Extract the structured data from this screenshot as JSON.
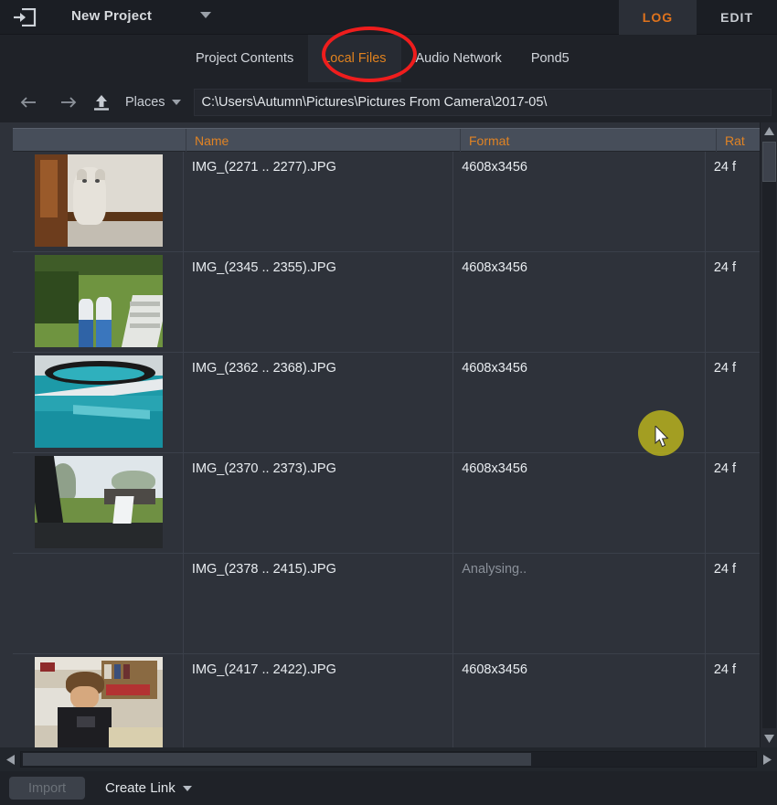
{
  "window": {
    "exit_icon": "exit-icon",
    "project_title": "New Project",
    "project_caret": "chevron-down-icon"
  },
  "mode_tabs": [
    {
      "label": "LOG",
      "active": true
    },
    {
      "label": "EDIT",
      "active": false
    }
  ],
  "sub_tabs": [
    {
      "label": "Project Contents",
      "active": false
    },
    {
      "label": "Local Files",
      "active": true
    },
    {
      "label": "Audio Network",
      "active": false
    },
    {
      "label": "Pond5",
      "active": false
    }
  ],
  "navbar": {
    "back_icon": "arrow-left-icon",
    "forward_icon": "arrow-right-icon",
    "up_icon": "arrow-up-folder-icon",
    "places_label": "Places",
    "places_caret": "chevron-down-icon",
    "path_value": "C:\\Users\\Autumn\\Pictures\\Pictures From Camera\\2017-05\\"
  },
  "table": {
    "columns": [
      {
        "key": "thumb",
        "label": ""
      },
      {
        "key": "name",
        "label": "Name"
      },
      {
        "key": "format",
        "label": "Format"
      },
      {
        "key": "rate",
        "label": "Rat"
      }
    ],
    "rows": [
      {
        "name": "IMG_(2271 .. 2277).JPG",
        "format": "4608x3456",
        "rate": "24 f",
        "analysing": false,
        "thumb": "cat-in-hallway"
      },
      {
        "name": "IMG_(2345 .. 2355).JPG",
        "format": "4608x3456",
        "rate": "24 f",
        "analysing": false,
        "thumb": "legs-on-lawn"
      },
      {
        "name": "IMG_(2362 .. 2368).JPG",
        "format": "4608x3456",
        "rate": "24 f",
        "analysing": false,
        "thumb": "teal-blanket"
      },
      {
        "name": "IMG_(2370 .. 2373).JPG",
        "format": "4608x3456",
        "rate": "24 f",
        "analysing": false,
        "thumb": "car-window-yard"
      },
      {
        "name": "IMG_(2378 .. 2415).JPG",
        "format": "Analysing..",
        "rate": "24 f",
        "analysing": true,
        "thumb": ""
      },
      {
        "name": "IMG_(2417 .. 2422).JPG",
        "format": "4608x3456",
        "rate": "24 f",
        "analysing": false,
        "thumb": "boy-at-desk"
      }
    ]
  },
  "scrollbars": {
    "vertical": {
      "up_icon": "triangle-up-icon",
      "down_icon": "triangle-down-icon"
    },
    "horizontal": {
      "left_icon": "triangle-left-icon",
      "right_icon": "triangle-right-icon"
    }
  },
  "footer": {
    "import_label": "Import",
    "import_disabled": true,
    "create_link_label": "Create Link",
    "create_link_caret": "chevron-down-icon"
  },
  "annotations": {
    "highlight_ellipse_target": "Local Files",
    "ellipse_color": "#ef1d1d",
    "cursor_highlight_color": "#b4ad1f"
  },
  "colors": {
    "accent_orange": "#e0821f",
    "panel_bg": "#2e323a",
    "chrome_bg": "#1f2228",
    "header_bg": "#474e5a"
  }
}
